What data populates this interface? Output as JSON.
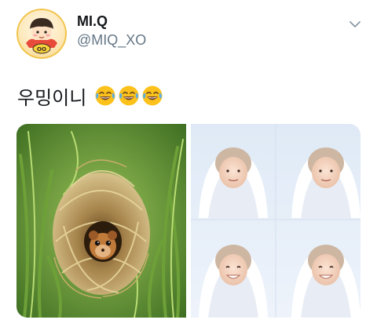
{
  "user": {
    "display_name": "MI.Q",
    "handle": "@MIQ_XO"
  },
  "tweet": {
    "text": "우밍이니",
    "emoji": [
      "face-with-tears-of-joy",
      "face-with-tears-of-joy",
      "face-with-tears-of-joy"
    ]
  },
  "media": {
    "left_photo": "harvest-mouse-in-grass-nest",
    "right_photo": "four-smiling-faces-in-white-hoods"
  },
  "colors": {
    "text": "#14171a",
    "secondary": "#657786",
    "emoji_yellow": "#fcc21b",
    "tear_blue": "#5dade2"
  }
}
